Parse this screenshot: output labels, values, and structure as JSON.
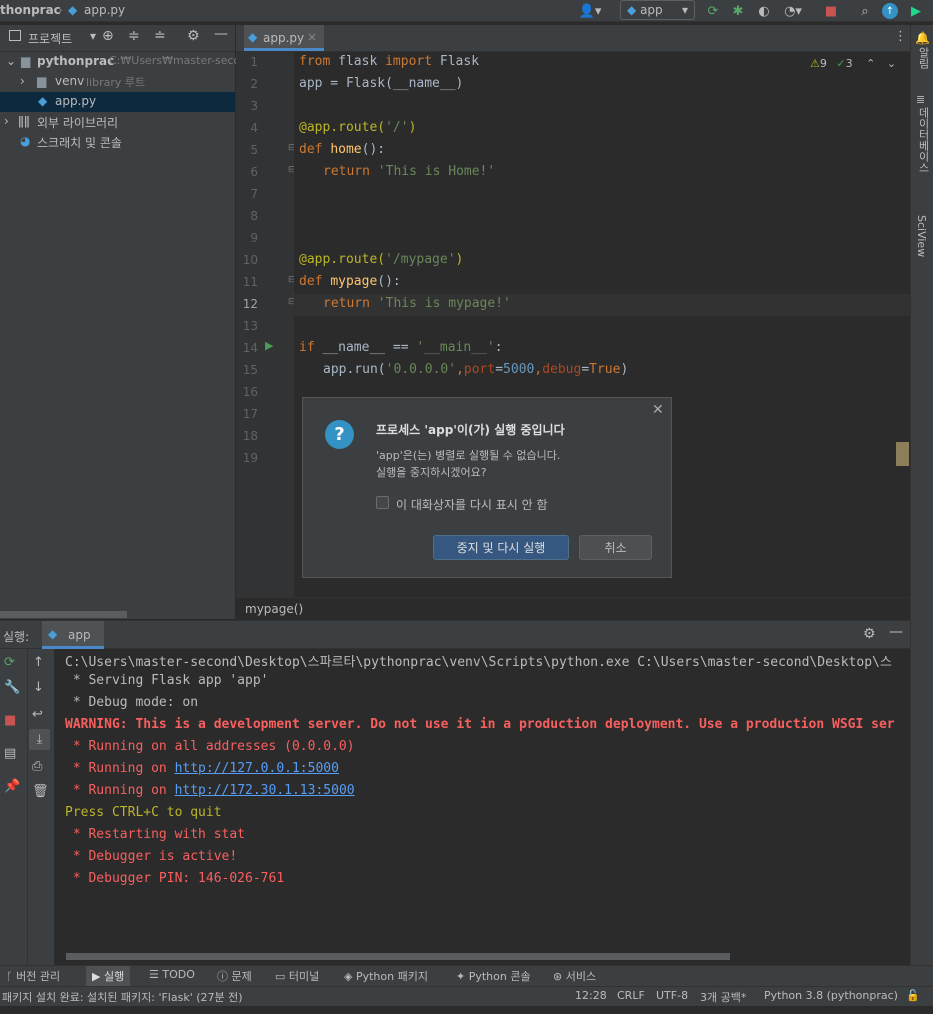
{
  "nav": {
    "project": "thonprac",
    "file": "app.py",
    "run_config": "app"
  },
  "project_panel": {
    "title": "프로젝트",
    "tree": [
      {
        "label": "pythonprac",
        "hint": "C:₩Users₩master-secon"
      },
      {
        "label": "venv",
        "hint": "library 루트"
      },
      {
        "label": "app.py",
        "hint": ""
      },
      {
        "label": "외부 라이브러리",
        "hint": ""
      },
      {
        "label": "스크래치 및 콘솔",
        "hint": ""
      }
    ]
  },
  "editor": {
    "tab": "app.py",
    "inspection": {
      "warnings": "9",
      "ok": "3"
    },
    "lines": [
      "1",
      "2",
      "3",
      "4",
      "5",
      "6",
      "7",
      "8",
      "9",
      "10",
      "11",
      "12",
      "13",
      "14",
      "15",
      "16",
      "17",
      "18",
      "19"
    ],
    "code": {
      "l1": [
        "from",
        " flask ",
        "import",
        " Flask"
      ],
      "l2": "app = Flask(__name__)",
      "l4": [
        "@app.route(",
        "'/'",
        ")"
      ],
      "l5": [
        "def ",
        "home",
        "():"
      ],
      "l6": [
        "return ",
        "'This is Home!'"
      ],
      "l10": [
        "@app.route(",
        "'/mypage'",
        ")"
      ],
      "l11": [
        "def ",
        "mypage",
        "():"
      ],
      "l12": [
        "return ",
        "'This is mypage!'"
      ],
      "l14": [
        "if ",
        "__name__ == ",
        "'__main__'",
        ":"
      ],
      "l15": [
        "app.run(",
        "'0.0.0.0'",
        ",",
        "port",
        "=",
        "5000",
        ",",
        "debug",
        "=",
        "True",
        ")"
      ]
    },
    "breadcrumb": "mypage()"
  },
  "right_sidebar": {
    "notifications": "알림",
    "database": "데이터베이스",
    "sciview": "SciView"
  },
  "dialog": {
    "title": "프로세스 'app'이(가) 실행 중입니다",
    "message1": "'app'은(는) 병렬로 실행될 수 없습니다.",
    "message2": "실행을 중지하시겠어요?",
    "checkbox": "이 대화상자를 다시 표시 안 함",
    "ok": "중지 및 다시 실행",
    "cancel": "취소"
  },
  "run_panel": {
    "label": "실행:",
    "tab": "app",
    "console": [
      "C:\\Users\\master-second\\Desktop\\스파르타\\pythonprac\\venv\\Scripts\\python.exe C:\\Users\\master-second\\Desktop\\스",
      " * Serving Flask app 'app'",
      " * Debug mode: on",
      "WARNING: This is a development server. Do not use it in a production deployment. Use a production WSGI ser",
      " * Running on all addresses (0.0.0.0)",
      " * Running on ",
      "http://127.0.0.1:5000",
      " * Running on ",
      "http://172.30.1.13:5000",
      "Press CTRL+C to quit",
      " * Restarting with stat",
      " * Debugger is active!",
      " * Debugger PIN: 146-026-761"
    ]
  },
  "bottom_tabs": [
    "버전 관리",
    "실행",
    "TODO",
    "문제",
    "터미널",
    "Python 패키지",
    "Python 콘솔",
    "서비스"
  ],
  "status": {
    "message": "패키지 설치 완료: 설치된 패키지: 'Flask' (27분 전)",
    "position": "12:28",
    "line_sep": "CRLF",
    "encoding": "UTF-8",
    "indent": "3개 공백*",
    "interpreter": "Python 3.8 (pythonprac)"
  }
}
